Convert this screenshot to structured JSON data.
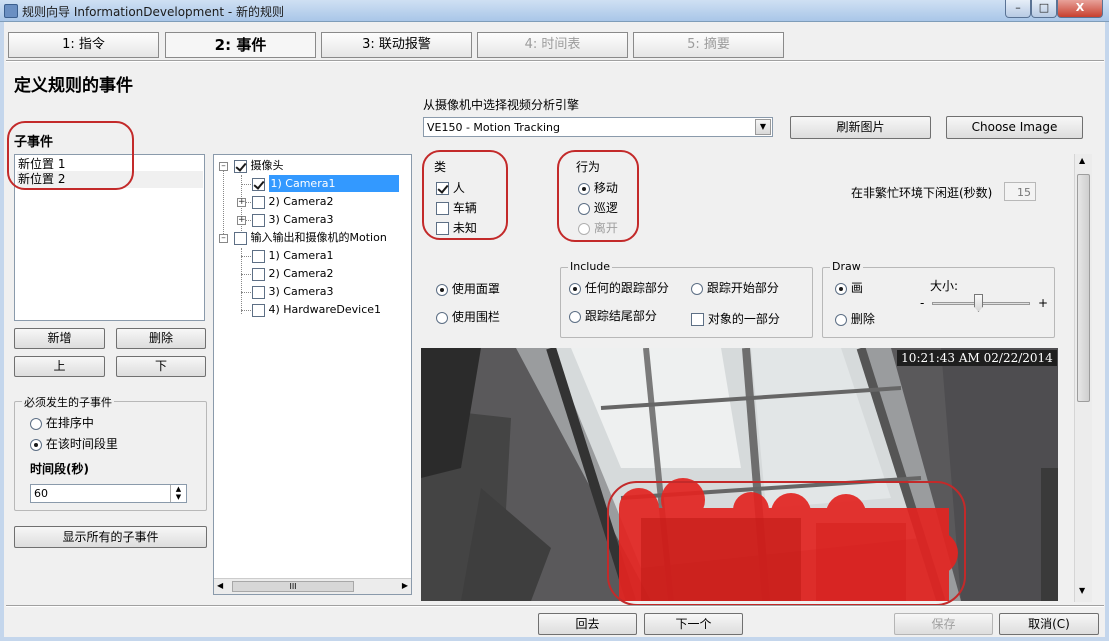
{
  "window": {
    "title": "规则向导 InformationDevelopment - 新的规则",
    "min": "–",
    "max": "□",
    "close": "X"
  },
  "tabs": [
    {
      "label": "1: 指令"
    },
    {
      "label": "2: 事件"
    },
    {
      "label": "3: 联动报警"
    },
    {
      "label": "4: 时间表"
    },
    {
      "label": "5: 摘要"
    }
  ],
  "page_title": "定义规则的事件",
  "subevents": {
    "label": "子事件",
    "items": [
      "新位置 1",
      "新位置 2"
    ]
  },
  "buttons": {
    "add": "新增",
    "delete": "删除",
    "up": "上",
    "down": "下",
    "show_all": "显示所有的子事件",
    "refresh": "刷新图片",
    "choose_image": "Choose Image",
    "back": "回去",
    "next": "下一个",
    "save": "保存",
    "cancel": "取消(C)"
  },
  "required": {
    "title": "必须发生的子事件",
    "opt_sequence": "在排序中",
    "opt_timeframe": "在该时间段里",
    "duration_label": "时间段(秒)",
    "duration_value": "60"
  },
  "tree": {
    "cameras": "摄像头",
    "cam1": "1) Camera1",
    "cam2": "2) Camera2",
    "cam3": "3) Camera3",
    "io": "输入输出和摄像机的Motion",
    "io1": "1) Camera1",
    "io2": "2) Camera2",
    "io3": "3) Camera3",
    "io4": "4) HardwareDevice1"
  },
  "engine": {
    "label": "从摄像机中选择视频分析引擎",
    "value": "VE150 - Motion Tracking"
  },
  "category": {
    "title": "类",
    "person": "人",
    "vehicle": "车辆",
    "unknown": "未知"
  },
  "behavior": {
    "title": "行为",
    "move": "移动",
    "patrol": "巡逻",
    "leave": "离开"
  },
  "idle": {
    "label": "在非繁忙环境下闲逛(秒数)",
    "value": "15"
  },
  "mask": {
    "use_mask": "使用面罩",
    "use_fence": "使用围栏"
  },
  "include": {
    "title": "Include",
    "any": "任何的跟踪部分",
    "start": "跟踪开始部分",
    "end": "跟踪结尾部分",
    "part": "对象的一部分"
  },
  "draw": {
    "title": "Draw",
    "paint": "画",
    "erase": "删除",
    "size": "大小:",
    "minus": "-",
    "plus": "+"
  },
  "video": {
    "timestamp": "10:21:43 AM 02/22/2014"
  },
  "hscroll": {
    "thumb": "III"
  }
}
